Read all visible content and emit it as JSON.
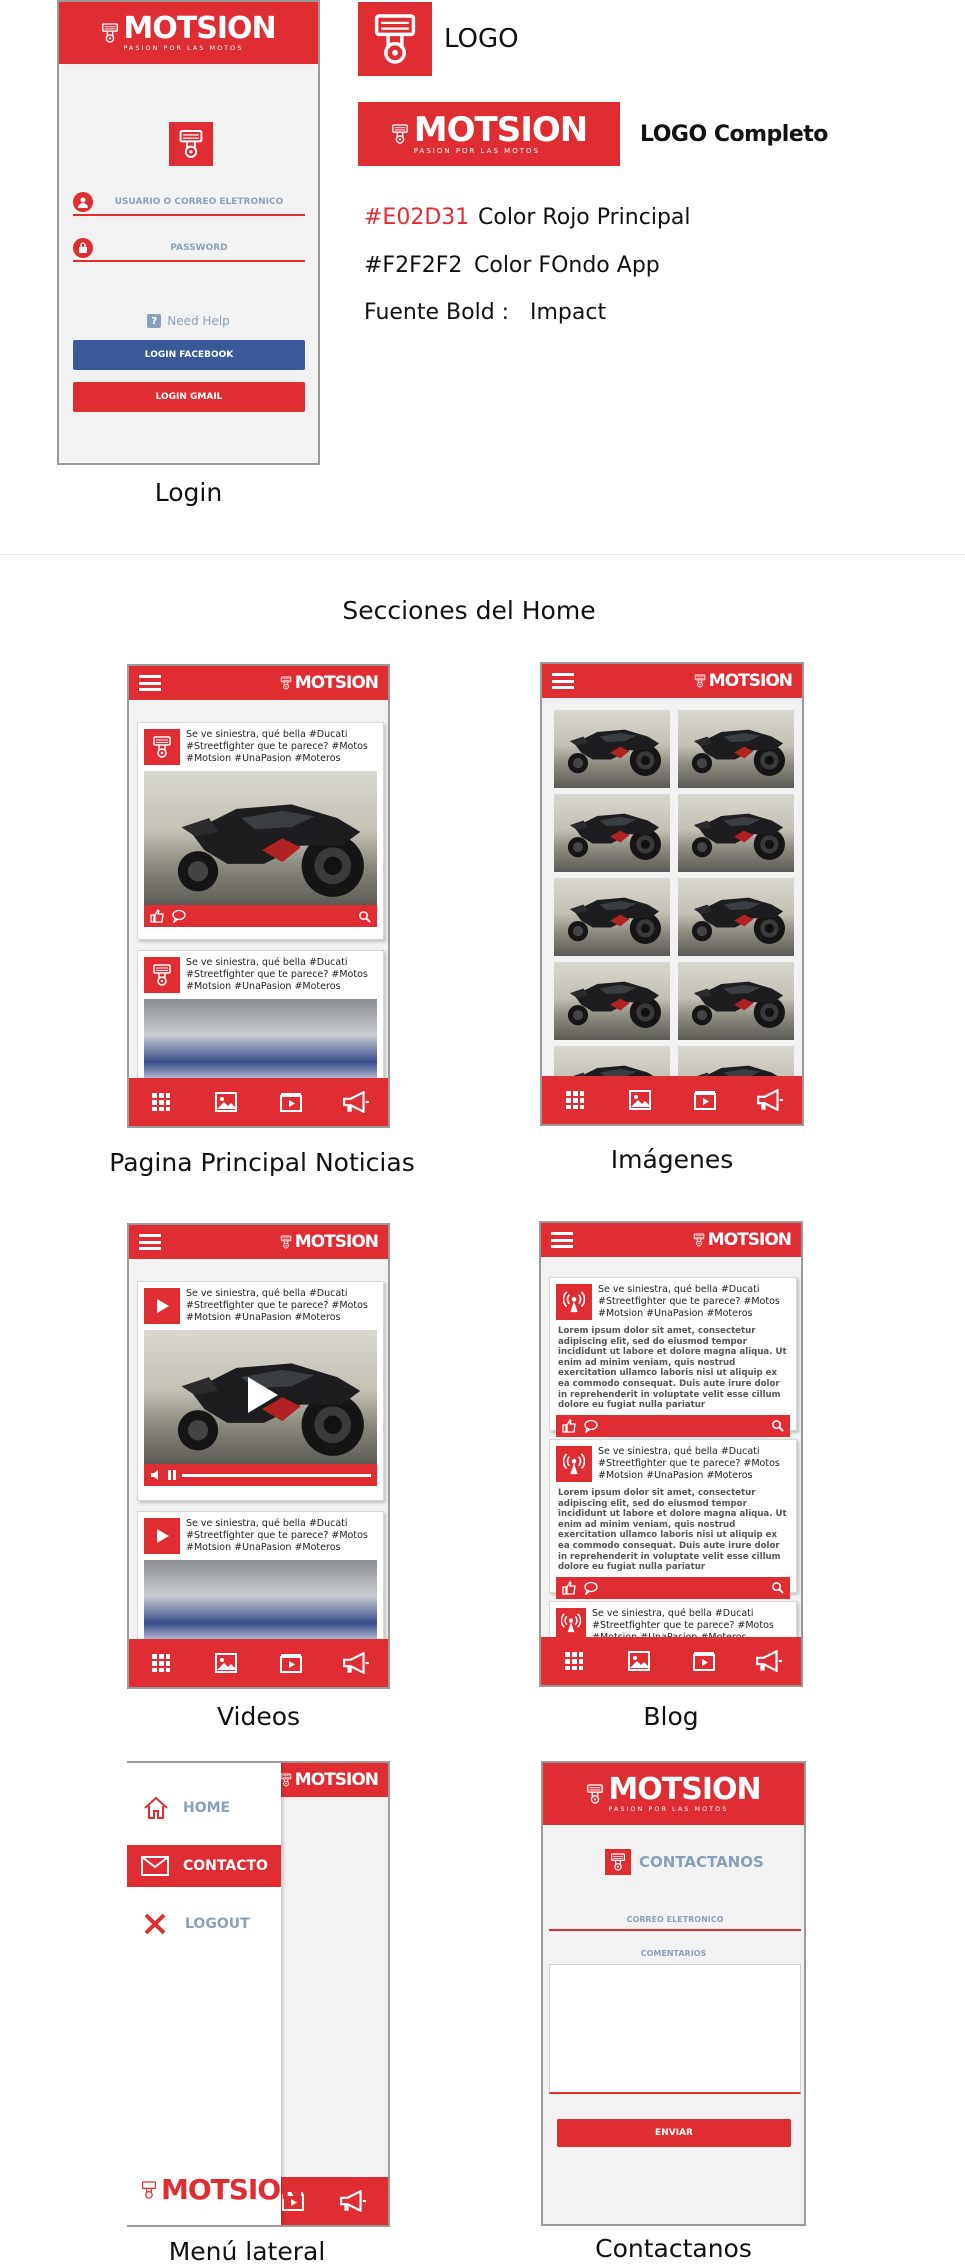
{
  "brand": {
    "name": "MOTSION",
    "tagline": "PASION POR LAS MOTOS"
  },
  "style_guide": {
    "logo_label": "LOGO",
    "logo_full_label": "LOGO Completo",
    "color_primary_hex": "#E02D31",
    "color_primary_label": "Color Rojo Principal",
    "color_bg_hex": "#F2F2F2",
    "color_bg_label": "Color FOndo App",
    "font_label": "Fuente Bold :",
    "font_value": "Impact"
  },
  "login": {
    "user_placeholder": "USUARIO O CORREO ELETRONICO",
    "password_placeholder": "PASSWORD",
    "help": "Need Help",
    "facebook_button": "LOGIN FACEBOOK",
    "gmail_button": "LOGIN GMAIL",
    "caption": "Login"
  },
  "sections_title": "Secciones del Home",
  "post": {
    "text": "Se ve siniestra, qué bella #Ducati #Streetfighter que te parece? #Motos #Motsion #UnaPasion #Moteros",
    "lorem": "Lorem ipsum dolor sit amet, consectetur adipiscing elit, sed do eiusmod tempor incididunt ut labore et dolore magna aliqua. Ut enim ad minim veniam, quis nostrud exercitation ullamco laboris nisi ut aliquip ex ea commodo consequat. Duis aute irure dolor in reprehenderit in voluptate velit esse cillum dolore eu fugiat nulla pariatur"
  },
  "captions": {
    "news": "Pagina Principal Noticias",
    "images": "Imágenes",
    "videos": "Videos",
    "blog": "Blog",
    "side_menu": "Menú lateral",
    "contact": "Contactanos"
  },
  "side_menu": {
    "home": "HOME",
    "contact": "CONTACTO",
    "logout": "LOGOUT"
  },
  "contact": {
    "title": "CONTACTANOS",
    "email_placeholder": "CORREO ELETRONICO",
    "comments_placeholder": "COMENTARIOS",
    "send_button": "ENVIAR"
  },
  "colors": {
    "primary": "#E02D31",
    "background": "#F2F2F2",
    "facebook": "#3B5998",
    "link": "#8aa0b8"
  },
  "icons": [
    "piston-icon",
    "hamburger-icon",
    "grid-icon",
    "image-icon",
    "video-icon",
    "megaphone-icon",
    "like-icon",
    "comment-icon",
    "zoom-icon",
    "play-icon",
    "volume-icon",
    "pause-icon",
    "broadcast-icon",
    "home-icon",
    "mail-icon",
    "close-icon",
    "user-icon",
    "lock-icon",
    "help-icon"
  ]
}
